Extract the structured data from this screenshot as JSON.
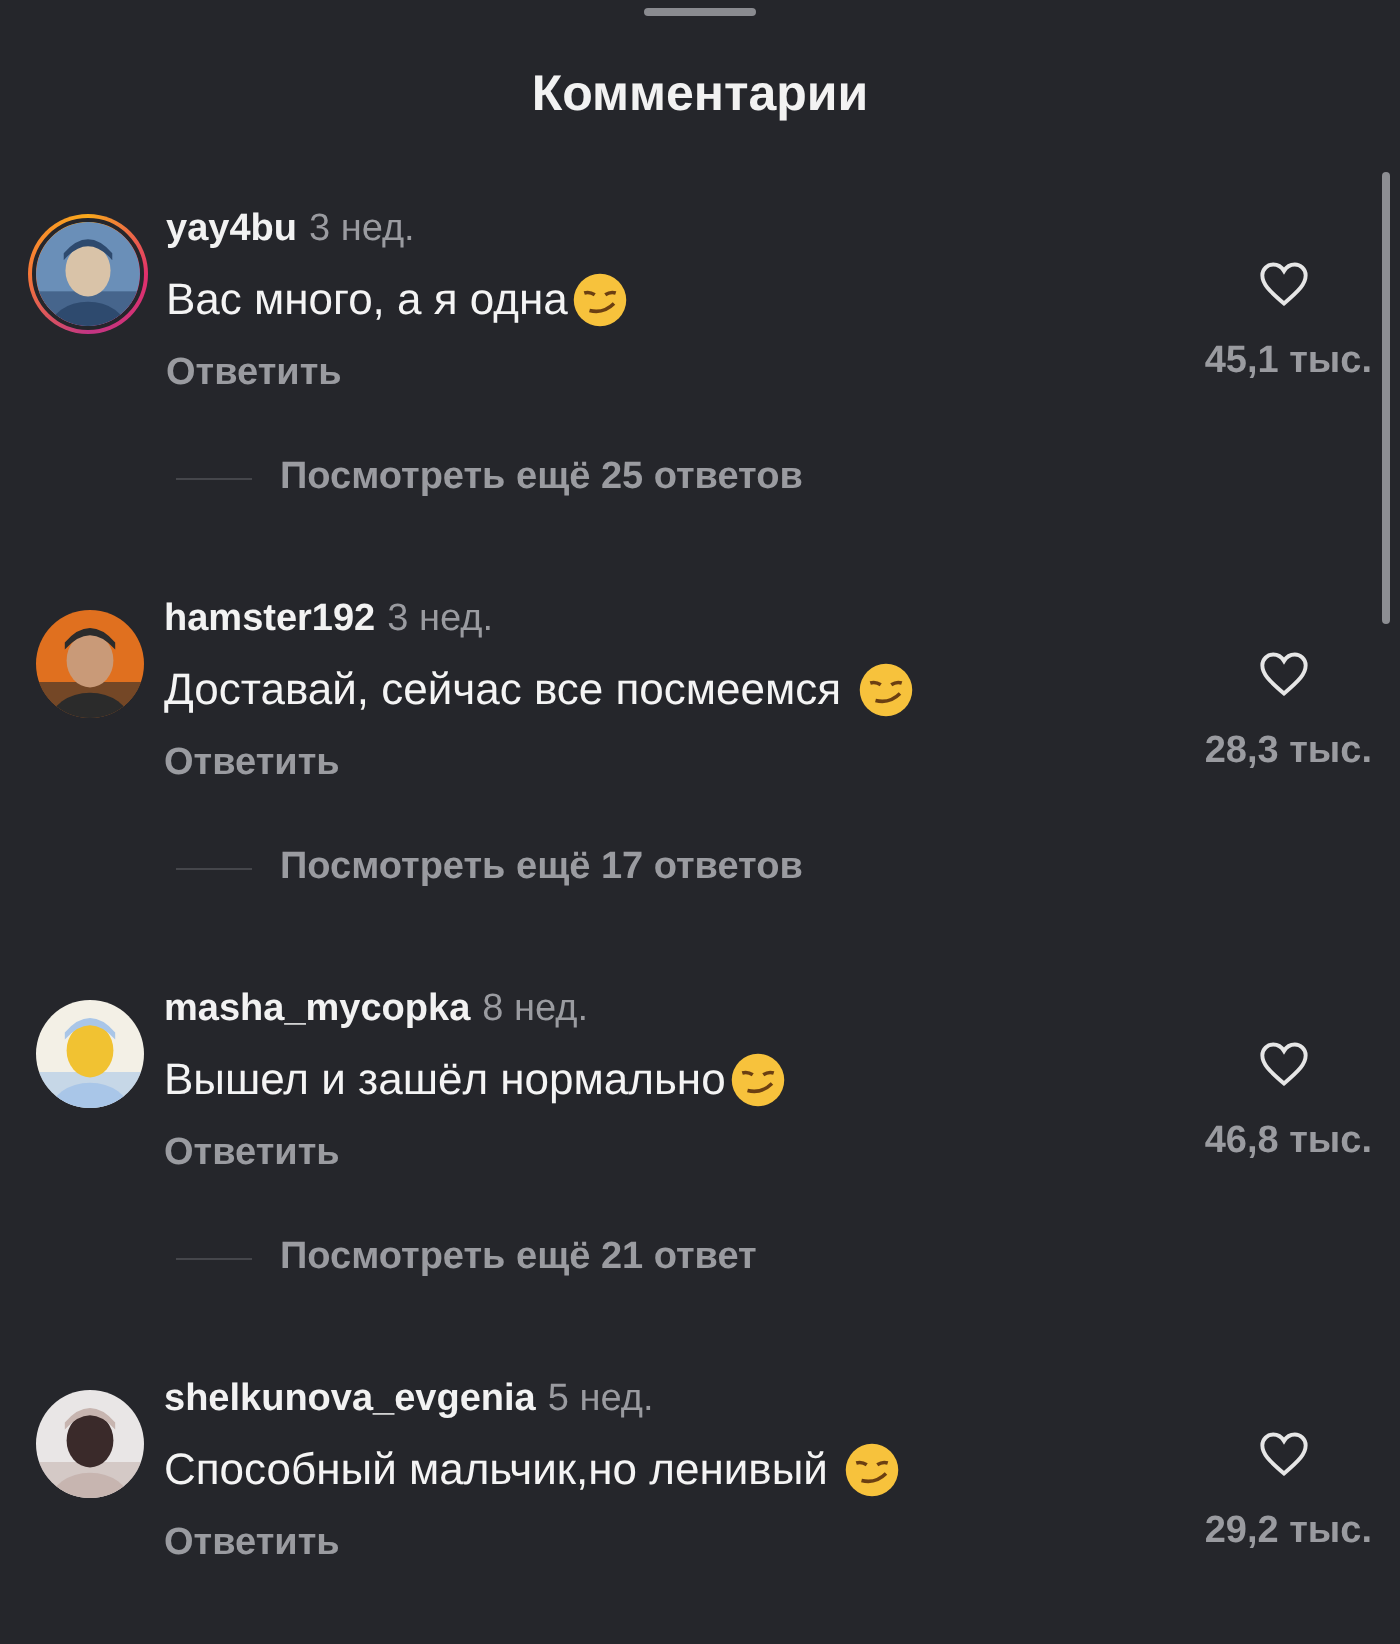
{
  "header": {
    "title": "Комментарии"
  },
  "comments": [
    {
      "username": "yay4bu",
      "time": "3 нед.",
      "text": "Вас много, а я одна",
      "has_emoji": true,
      "story_ring": true,
      "reply": "Ответить",
      "likes": "45,1 тыс.",
      "more_replies": "Посмотреть ещё 25 ответов"
    },
    {
      "username": "hamster192",
      "time": "3 нед.",
      "text": "Доставай, сейчас все посмеемся ",
      "has_emoji": true,
      "story_ring": false,
      "reply": "Ответить",
      "likes": "28,3 тыс.",
      "more_replies": "Посмотреть ещё 17 ответов"
    },
    {
      "username": "masha_mycopka",
      "time": "8 нед.",
      "text": "Вышел и зашёл нормально",
      "has_emoji": true,
      "story_ring": false,
      "reply": "Ответить",
      "likes": "46,8 тыс.",
      "more_replies": "Посмотреть ещё 21 ответ"
    },
    {
      "username": "shelkunova_evgenia",
      "time": "5 нед.",
      "text": "Способный мальчик,но ленивый ",
      "has_emoji": true,
      "story_ring": false,
      "reply": "Ответить",
      "likes": "29,2 тыс."
    }
  ]
}
